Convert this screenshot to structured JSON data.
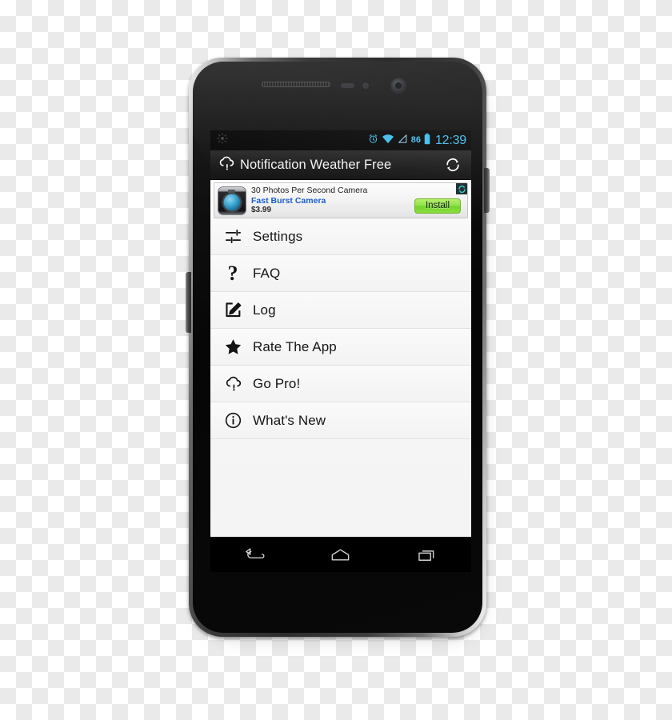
{
  "device": {
    "type": "android-smartphone",
    "hardware": {
      "earpiece": "earpiece-speaker",
      "front_camera": "front-camera",
      "proximity_sensor": "proximity-sensor",
      "volume_button": "volume-rocker",
      "power_button": "power-button"
    }
  },
  "status_bar": {
    "brightness_icon": "sun-icon",
    "alarm_icon": "alarm-clock-icon",
    "wifi_icon": "wifi-icon",
    "signal_icon": "cell-signal-icon",
    "battery_percent": "86",
    "battery_icon": "battery-icon",
    "time": "12:39",
    "accent_color": "#42bdec",
    "background_color": "#0a0a0a"
  },
  "action_bar": {
    "logo_icon": "cloud-drop-logo-icon",
    "title": "Notification Weather Free",
    "refresh_icon": "refresh-icon",
    "background_color": "#1d1d1d",
    "title_color": "#f3f3f3"
  },
  "ad_banner": {
    "thumbnail_icon": "camera-app-icon",
    "headline": "30 Photos Per Second Camera",
    "app_name": "Fast Burst Camera",
    "price": "$3.99",
    "cta_label": "Install",
    "cta_color": "#8fe24a",
    "refresh_icon": "ad-refresh-icon",
    "link_color": "#1a5fd0"
  },
  "menu": {
    "items": [
      {
        "label": "Settings",
        "icon": "sliders-icon"
      },
      {
        "label": "FAQ",
        "icon": "question-mark-icon"
      },
      {
        "label": "Log",
        "icon": "edit-square-icon"
      },
      {
        "label": "Rate The App",
        "icon": "star-icon"
      },
      {
        "label": "Go Pro!",
        "icon": "cloud-drop-icon"
      },
      {
        "label": "What's New",
        "icon": "info-circle-icon"
      }
    ]
  },
  "nav_bar": {
    "back_icon": "back-arrow-icon",
    "home_icon": "home-icon",
    "recents_icon": "recent-apps-icon",
    "background_color": "#000000"
  }
}
